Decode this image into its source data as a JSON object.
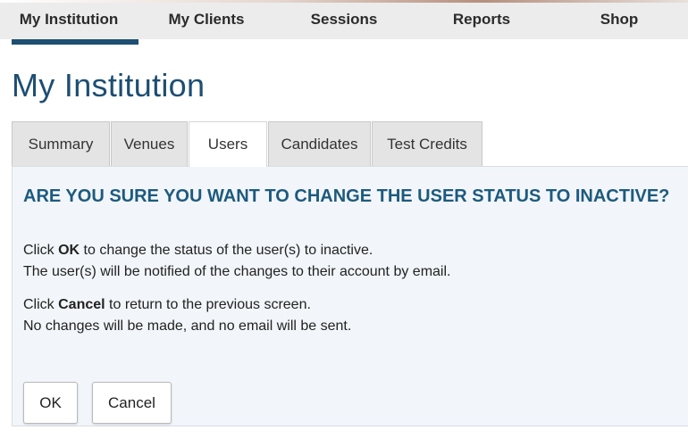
{
  "nav": {
    "items": [
      {
        "label": "My Institution",
        "active": true
      },
      {
        "label": "My Clients",
        "active": false
      },
      {
        "label": "Sessions",
        "active": false
      },
      {
        "label": "Reports",
        "active": false
      },
      {
        "label": "Shop",
        "active": false
      }
    ]
  },
  "page": {
    "title": "My Institution"
  },
  "tabs": [
    {
      "label": "Summary",
      "active": false
    },
    {
      "label": "Venues",
      "active": false
    },
    {
      "label": "Users",
      "active": true
    },
    {
      "label": "Candidates",
      "active": false
    },
    {
      "label": "Test Credits",
      "active": false
    }
  ],
  "dialog": {
    "heading": "ARE YOU SURE YOU WANT TO CHANGE THE USER STATUS TO INACTIVE?",
    "ok_line": {
      "prefix": "Click ",
      "keyword": "OK",
      "suffix": " to change the status of the user(s) to inactive."
    },
    "ok_note": "The user(s) will be notified of the changes to their account by email.",
    "cancel_line": {
      "prefix": "Click ",
      "keyword": "Cancel",
      "suffix": " to return to the previous screen."
    },
    "cancel_note": "No changes will be made, and no email will be sent.",
    "ok_button": "OK",
    "cancel_button": "Cancel"
  },
  "colors": {
    "brand": "#1d4e73",
    "heading": "#1d5a7e",
    "panel_bg": "#f2f6fa"
  }
}
